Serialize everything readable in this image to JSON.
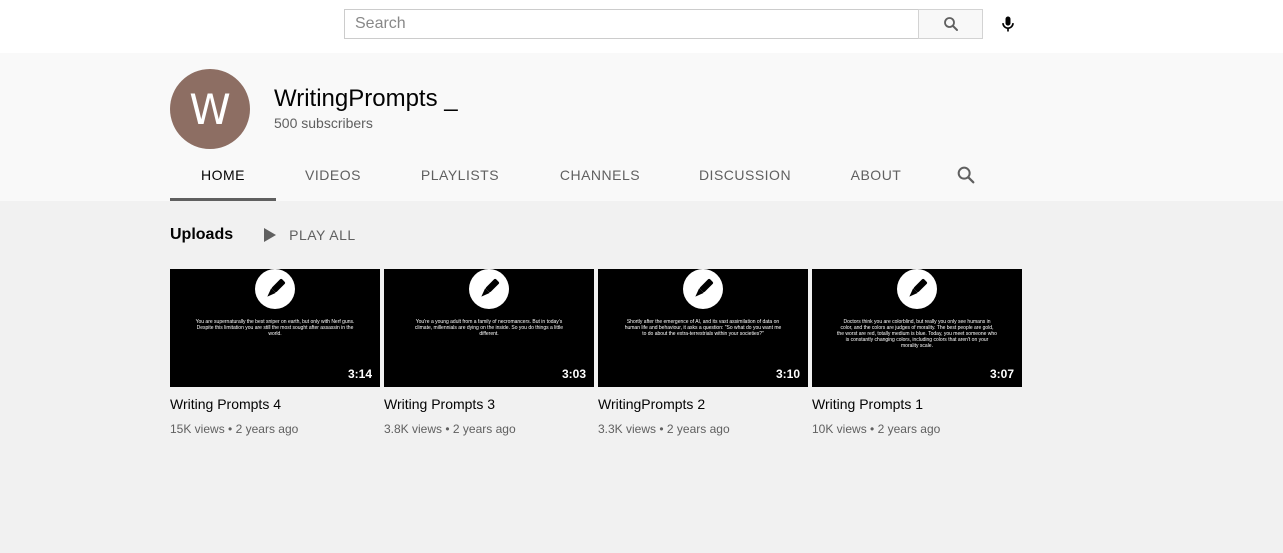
{
  "search": {
    "placeholder": "Search"
  },
  "channel": {
    "avatar_letter": "W",
    "avatar_color": "#8d6e63",
    "name": "WritingPrompts _",
    "subscribers": "500 subscribers"
  },
  "tabs": [
    {
      "label": "HOME",
      "active": true
    },
    {
      "label": "VIDEOS"
    },
    {
      "label": "PLAYLISTS"
    },
    {
      "label": "CHANNELS"
    },
    {
      "label": "DISCUSSION"
    },
    {
      "label": "ABOUT"
    }
  ],
  "uploads": {
    "title": "Uploads",
    "play_all": "PLAY ALL"
  },
  "videos": [
    {
      "title": "Writing Prompts 4",
      "duration": "3:14",
      "views": "15K views",
      "age": "2 years ago",
      "thumb_text": "You are supernaturally the best sniper on earth, but only with Nerf guns. Despite this limitation you are still the most sought after assassin in the world."
    },
    {
      "title": "Writing Prompts 3",
      "duration": "3:03",
      "views": "3.8K views",
      "age": "2 years ago",
      "thumb_text": "You're a young adult from a family of necromancers. But in today's climate, millennials are dying on the inside. So you do things a little different."
    },
    {
      "title": "WritingPrompts 2",
      "duration": "3:10",
      "views": "3.3K views",
      "age": "2 years ago",
      "thumb_text": "Shortly after the emergence of AI, and its vast assimilation of data on human life and behaviour, it asks a question: \"So what do you want me to do about the extra-terrestrials within your societies?\""
    },
    {
      "title": "Writing Prompts 1",
      "duration": "3:07",
      "views": "10K views",
      "age": "2 years ago",
      "thumb_text": "Doctors think you are colorblind, but really you only see humans in color, and the colors are judges of morality. The best people are gold, the worst are red, totally medium is blue. Today, you meet someone who is constantly changing colors, including colors that aren't on your morality scale."
    }
  ],
  "meta_separator": "•"
}
